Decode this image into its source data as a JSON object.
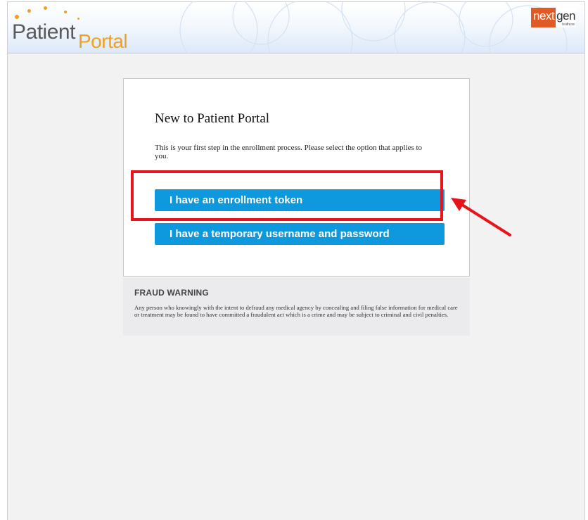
{
  "header": {
    "logo_patient": "Patient",
    "logo_portal": "Portal",
    "brand_next": "next",
    "brand_gen": "gen",
    "brand_sub": "healthcare"
  },
  "card": {
    "title": "New to Patient Portal",
    "description": "This is your first step in the enrollment process. Please select the option that applies to you.",
    "options": [
      {
        "label": "I have an enrollment token"
      },
      {
        "label": "I have a temporary username and password"
      }
    ]
  },
  "fraud_warning": {
    "title": "FRAUD WARNING",
    "text": "Any person who knowingly with the intent to defraud any medical agency by concealing and filing false information for medical care or treatment may be found to have committed a fraudulent act which is a crime and may be subject to criminal and civil penalties."
  },
  "colors": {
    "button": "#0e98dd",
    "highlight": "#e8141b",
    "logo_orange": "#f0a020",
    "brand_orange": "#e15a26",
    "page_background": "#f2f2f2"
  },
  "icons": {
    "annotation_arrow": "red-arrow-icon",
    "highlight_box": "red-highlight-box"
  }
}
